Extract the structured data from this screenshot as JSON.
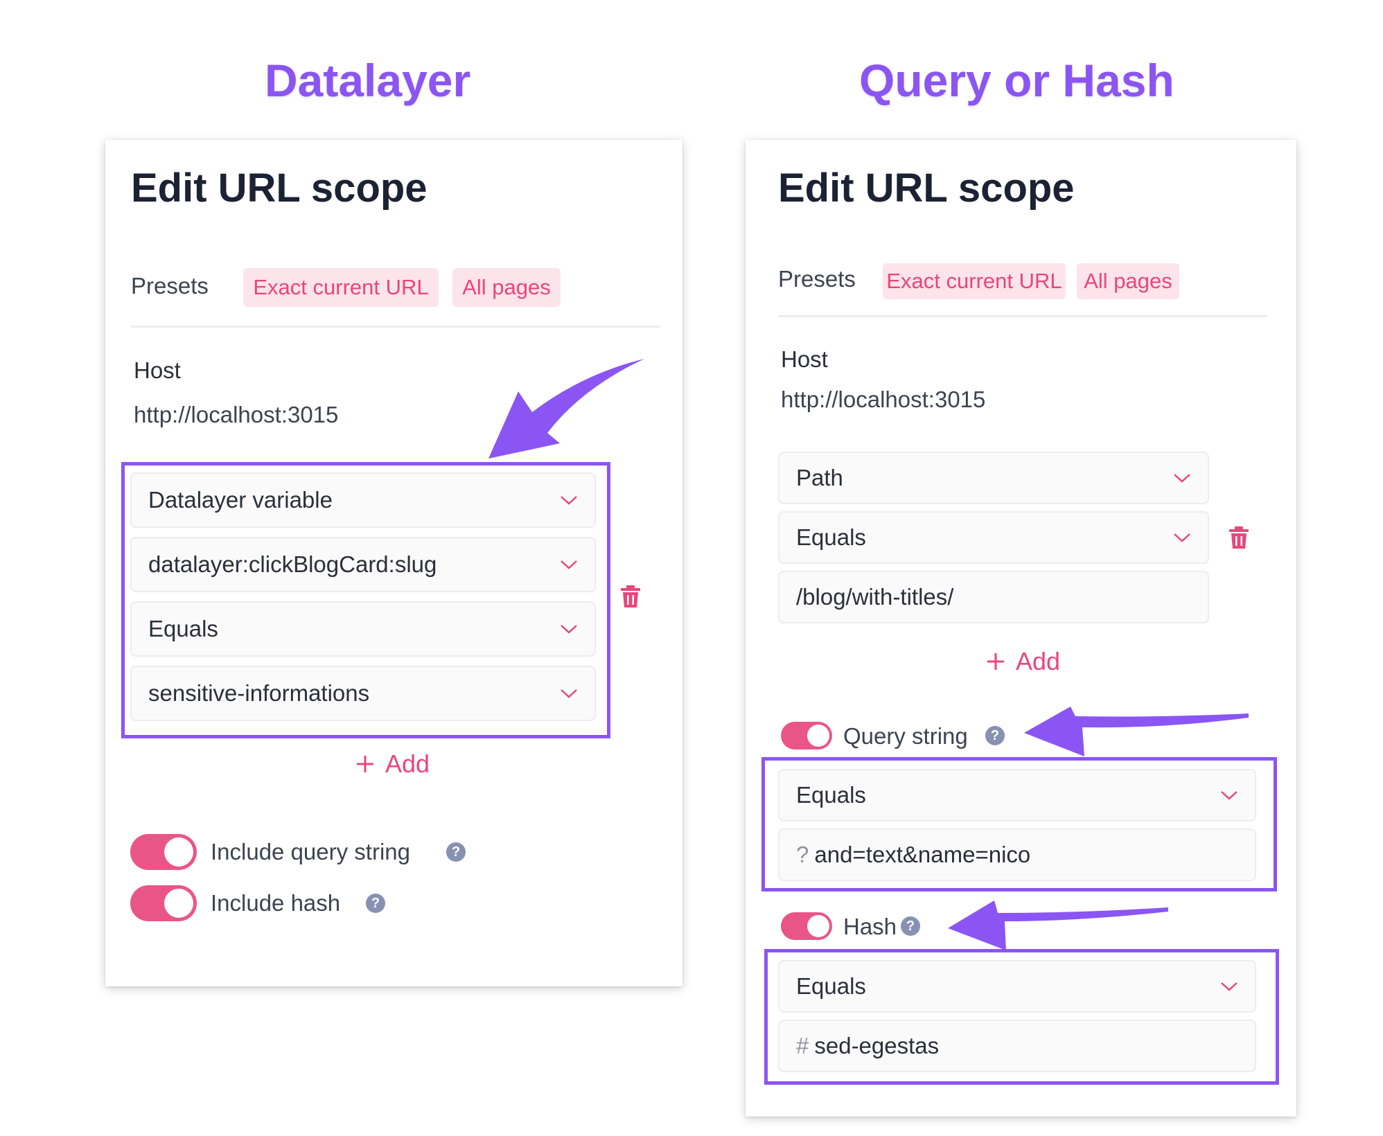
{
  "headings": {
    "left": "Datalayer",
    "right": "Query or Hash"
  },
  "colors": {
    "accent_purple": "#8b55f3",
    "pink": "#e8467c",
    "chip_bg": "#fde3ea",
    "toggle_on": "#ea5588"
  },
  "left_panel": {
    "title": "Edit URL scope",
    "presets_label": "Presets",
    "presets": [
      "Exact current URL",
      "All pages"
    ],
    "host_label": "Host",
    "host_value": "http://localhost:3015",
    "fields": [
      "Datalayer variable",
      "datalayer:clickBlogCard:slug",
      "Equals",
      "sensitive-informations"
    ],
    "add_label": "Add",
    "toggles": [
      {
        "label": "Include query string",
        "on": true,
        "icon": "help-icon"
      },
      {
        "label": "Include hash",
        "on": true,
        "icon": "help-icon"
      }
    ]
  },
  "right_panel": {
    "title": "Edit URL scope",
    "presets_label": "Presets",
    "presets": [
      "Exact current URL",
      "All pages"
    ],
    "host_label": "Host",
    "host_value": "http://localhost:3015",
    "path_select": "Path",
    "operator_select": "Equals",
    "path_value": "/blog/with-titles/",
    "add_label": "Add",
    "query": {
      "label": "Query string",
      "on": true,
      "operator": "Equals",
      "prefix": "?",
      "value": "and=text&name=nico"
    },
    "hash": {
      "label": "Hash",
      "on": true,
      "operator": "Equals",
      "prefix": "#",
      "value": "sed-egestas"
    }
  }
}
